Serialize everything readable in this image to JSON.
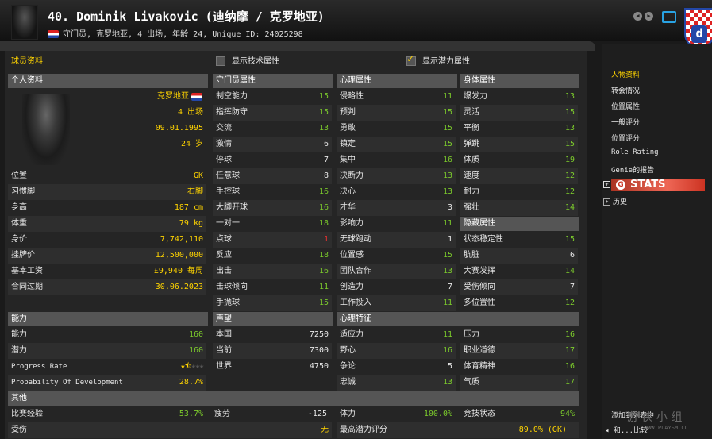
{
  "header": {
    "title": "40. Dominik Livakovic (迪纳摩 / 克罗地亚)",
    "subtitle": "守门员, 克罗地亚, 4 出场, 年龄 24, Unique ID: 24025298"
  },
  "options": {
    "section_label": "球员资料",
    "show_tech": "显示技术属性",
    "show_tech_checked": false,
    "show_potential": "显示潜力属性",
    "show_potential_checked": true
  },
  "personal": {
    "title": "个人资料",
    "nation": "克罗地亚",
    "caps": "4 出场",
    "dob": "09.01.1995",
    "age": "24 岁",
    "rows": [
      {
        "label": "位置",
        "value": "GK"
      },
      {
        "label": "习惯脚",
        "value": "右脚"
      },
      {
        "label": "身高",
        "value": "187 cm"
      },
      {
        "label": "体重",
        "value": "79 kg"
      },
      {
        "label": "身价",
        "value": "7,742,110"
      },
      {
        "label": "挂牌价",
        "value": "12,500,000"
      },
      {
        "label": "基本工资",
        "value": "£9,940 每周"
      },
      {
        "label": "合同过期",
        "value": "30.06.2023"
      }
    ]
  },
  "gk_attrs": {
    "title": "守门员属性",
    "rows": [
      {
        "label": "制空能力",
        "value": "15"
      },
      {
        "label": "指挥防守",
        "value": "15"
      },
      {
        "label": "交流",
        "value": "13"
      },
      {
        "label": "激情",
        "value": "6"
      },
      {
        "label": "停球",
        "value": "7"
      },
      {
        "label": "任意球",
        "value": "8"
      },
      {
        "label": "手控球",
        "value": "16"
      },
      {
        "label": "大脚开球",
        "value": "16"
      },
      {
        "label": "一对一",
        "value": "18"
      },
      {
        "label": "点球",
        "value": "1"
      },
      {
        "label": "反应",
        "value": "18"
      },
      {
        "label": "出击",
        "value": "16"
      },
      {
        "label": "击球倾向",
        "value": "11"
      },
      {
        "label": "手抛球",
        "value": "15"
      }
    ]
  },
  "mental_attrs": {
    "title": "心理属性",
    "rows": [
      {
        "label": "侵略性",
        "value": "11"
      },
      {
        "label": "预判",
        "value": "15"
      },
      {
        "label": "勇敢",
        "value": "15"
      },
      {
        "label": "镇定",
        "value": "15"
      },
      {
        "label": "集中",
        "value": "16"
      },
      {
        "label": "决断力",
        "value": "13"
      },
      {
        "label": "决心",
        "value": "13"
      },
      {
        "label": "才华",
        "value": "3"
      },
      {
        "label": "影响力",
        "value": "11"
      },
      {
        "label": "无球跑动",
        "value": "1"
      },
      {
        "label": "位置感",
        "value": "15"
      },
      {
        "label": "团队合作",
        "value": "13"
      },
      {
        "label": "创造力",
        "value": "7"
      },
      {
        "label": "工作投入",
        "value": "11"
      }
    ]
  },
  "physical_attrs": {
    "title": "身体属性",
    "rows": [
      {
        "label": "爆发力",
        "value": "13"
      },
      {
        "label": "灵活",
        "value": "15"
      },
      {
        "label": "平衡",
        "value": "13"
      },
      {
        "label": "弹跳",
        "value": "15"
      },
      {
        "label": "体质",
        "value": "19"
      },
      {
        "label": "速度",
        "value": "12"
      },
      {
        "label": "耐力",
        "value": "12"
      },
      {
        "label": "强壮",
        "value": "14"
      }
    ]
  },
  "hidden_attrs": {
    "title": "隐藏属性",
    "rows": [
      {
        "label": "状态稳定性",
        "value": "15"
      },
      {
        "label": "肮脏",
        "value": "6"
      },
      {
        "label": "大赛发挥",
        "value": "14"
      },
      {
        "label": "受伤倾向",
        "value": "7"
      },
      {
        "label": "多位置性",
        "value": "12"
      }
    ]
  },
  "ability": {
    "title": "能力",
    "ca_label": "能力",
    "ca_value": "160",
    "pa_label": "潜力",
    "pa_value": "160",
    "progress_label": "Progress Rate",
    "progress_stars": 1.5,
    "progress_max": 5,
    "prob_label": "Probability Of Development",
    "prob_value": "28.7%"
  },
  "reputation": {
    "title": "声望",
    "rows": [
      {
        "label": "本国",
        "value": "7250"
      },
      {
        "label": "当前",
        "value": "7300"
      },
      {
        "label": "世界",
        "value": "4750"
      }
    ]
  },
  "personality": {
    "title": "心理特征",
    "left": [
      {
        "label": "适应力",
        "value": "11"
      },
      {
        "label": "野心",
        "value": "16"
      },
      {
        "label": "争论",
        "value": "5"
      },
      {
        "label": "忠诚",
        "value": "13"
      }
    ],
    "right": [
      {
        "label": "压力",
        "value": "16"
      },
      {
        "label": "职业道德",
        "value": "17"
      },
      {
        "label": "体育精神",
        "value": "16"
      },
      {
        "label": "气质",
        "value": "17"
      }
    ]
  },
  "other": {
    "title": "其他",
    "match_exp_label": "比赛经验",
    "match_exp_value": "53.7%",
    "fatigue_label": "疲劳",
    "fatigue_value": "-125",
    "condition_label": "体力",
    "condition_value": "100.0%",
    "fitness_label": "竞技状态",
    "fitness_value": "94%",
    "injury_label": "受伤",
    "injury_value": "无",
    "max_pot_label": "最高潜力评分",
    "max_pot_value": "89.0% (GK)"
  },
  "sidebar": {
    "items": [
      "人物资料",
      "转会情况",
      "位置属性",
      "一般评分",
      "位置评分",
      "Role Rating",
      "Genie的报告"
    ],
    "stats_label": "STATS",
    "history_label": "历史",
    "add_to_list": "添加到列表中",
    "compare": "和...比较"
  },
  "watermark": {
    "text": "游 侠 小 组",
    "url": "WWW.PLAYSM.CC"
  },
  "colors": {
    "value_green": "#7ccb2c",
    "value_yellow": "#ffd400",
    "value_red": "#e03030",
    "header_bg": "#555555"
  }
}
